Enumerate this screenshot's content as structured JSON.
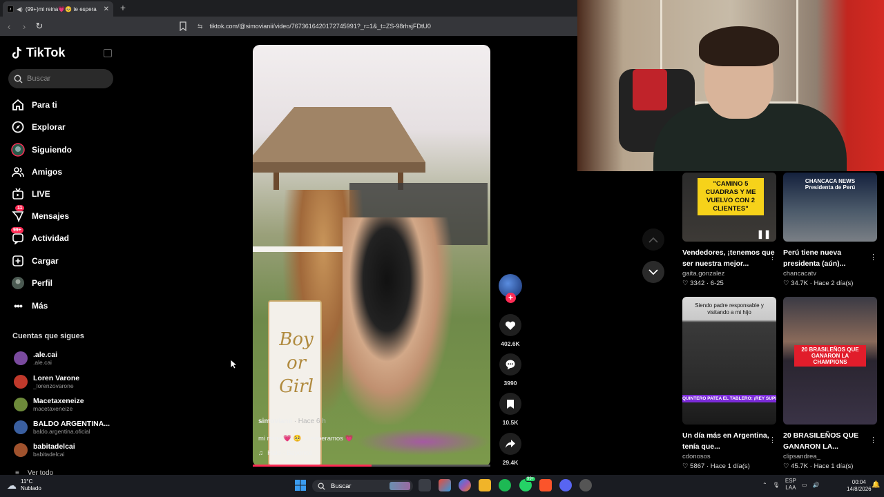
{
  "browser": {
    "tab_title": "(99+)mi reina💗🥺 te espera",
    "url": "tiktok.com/@simovianii/video/7673616420172745991?_r=1&_t=ZS-98rhsjFDtU0"
  },
  "sidebar": {
    "logo": "TikTok",
    "search_placeholder": "Buscar",
    "nav": [
      {
        "label": "Para ti"
      },
      {
        "label": "Explorar"
      },
      {
        "label": "Siguiendo"
      },
      {
        "label": "Amigos"
      },
      {
        "label": "LIVE"
      },
      {
        "label": "Mensajes",
        "badge": "11"
      },
      {
        "label": "Actividad",
        "badge": "99+"
      },
      {
        "label": "Cargar"
      },
      {
        "label": "Perfil"
      },
      {
        "label": "Más"
      }
    ],
    "following_heading": "Cuentas que sigues",
    "accounts": [
      {
        "name": ".ale.cai",
        "handle": ".ale.cai",
        "color": "#7a4a9e"
      },
      {
        "name": "Loren Varone",
        "handle": "_lorenzovarone",
        "color": "#c0392b"
      },
      {
        "name": "Macetaxeneize",
        "handle": "macetaxeneize",
        "color": "#6d8a3a"
      },
      {
        "name": "BALDO ARGENTINA...",
        "handle": "baldo.argentina.oficial",
        "color": "#3a5fa0"
      },
      {
        "name": "babitadelcai",
        "handle": "babitadelcai",
        "color": "#a0522d"
      }
    ],
    "see_all": "Ver todo"
  },
  "video": {
    "author": "simovianii",
    "time": "· Hace 6 h",
    "caption": "mi reina 💗 🥺 te esperamos 💗",
    "music": "Halo - Beyoncé",
    "board_text": [
      "Boy",
      "or",
      "Girl"
    ],
    "progress": 0.5
  },
  "actions": {
    "likes": "402.6K",
    "comments": "3990",
    "saves": "10.5K",
    "shares": "29.4K"
  },
  "suggested": [
    {
      "title": "Vendedores, ¡tenemos que ser nuestra mejor...",
      "author": "gaita.gonzalez",
      "likes": "3342",
      "date": "6-25",
      "overlay": "\"CAMINO 5 CUADRAS Y ME VUELVO CON 2 CLIENTES\""
    },
    {
      "title": "Perú tiene nueva presidenta (aún)...",
      "author": "chancacatv",
      "likes": "34.7K",
      "date": "Hace 2 día(s)",
      "overlay": "CHANCACA NEWS Presidenta de Perú"
    },
    {
      "title": "Un día más en Argentina, tenía que...",
      "author": "cdonosos",
      "likes": "5867",
      "date": "Hace 1 día(s)",
      "overlay": "Siendo padre responsable y visitando a mi hijo",
      "overlay2": "QUINTERO PATEA EL TABLERO: ¡REY SUPL"
    },
    {
      "title": "20 BRASILEÑOS QUE GANARON LA...",
      "author": "clipsandrea_",
      "likes": "45.7K",
      "date": "Hace 1 día(s)",
      "overlay": "20 BRASILEÑOS QUE GANARON LA CHAMPIONS"
    }
  ],
  "taskbar": {
    "temp": "11°C",
    "weather": "Nublado",
    "search": "Buscar",
    "whatsapp_badge": "99+",
    "lang": "ESP",
    "lang2": "LAA",
    "time": "00:04",
    "date": "14/8/2026"
  },
  "colors": {
    "accent": "#fe2c55",
    "bg": "#000000"
  }
}
